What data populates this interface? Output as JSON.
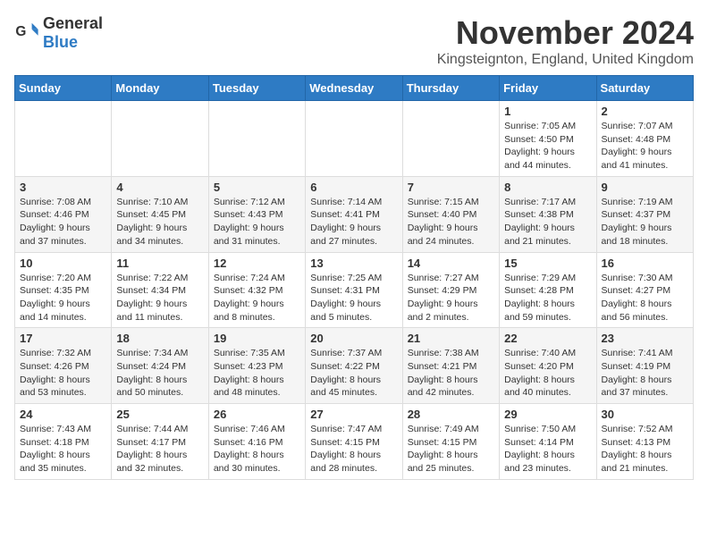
{
  "logo": {
    "text_general": "General",
    "text_blue": "Blue"
  },
  "title": "November 2024",
  "location": "Kingsteignton, England, United Kingdom",
  "days_of_week": [
    "Sunday",
    "Monday",
    "Tuesday",
    "Wednesday",
    "Thursday",
    "Friday",
    "Saturday"
  ],
  "weeks": [
    [
      {
        "day": "",
        "info": ""
      },
      {
        "day": "",
        "info": ""
      },
      {
        "day": "",
        "info": ""
      },
      {
        "day": "",
        "info": ""
      },
      {
        "day": "",
        "info": ""
      },
      {
        "day": "1",
        "info": "Sunrise: 7:05 AM\nSunset: 4:50 PM\nDaylight: 9 hours and 44 minutes."
      },
      {
        "day": "2",
        "info": "Sunrise: 7:07 AM\nSunset: 4:48 PM\nDaylight: 9 hours and 41 minutes."
      }
    ],
    [
      {
        "day": "3",
        "info": "Sunrise: 7:08 AM\nSunset: 4:46 PM\nDaylight: 9 hours and 37 minutes."
      },
      {
        "day": "4",
        "info": "Sunrise: 7:10 AM\nSunset: 4:45 PM\nDaylight: 9 hours and 34 minutes."
      },
      {
        "day": "5",
        "info": "Sunrise: 7:12 AM\nSunset: 4:43 PM\nDaylight: 9 hours and 31 minutes."
      },
      {
        "day": "6",
        "info": "Sunrise: 7:14 AM\nSunset: 4:41 PM\nDaylight: 9 hours and 27 minutes."
      },
      {
        "day": "7",
        "info": "Sunrise: 7:15 AM\nSunset: 4:40 PM\nDaylight: 9 hours and 24 minutes."
      },
      {
        "day": "8",
        "info": "Sunrise: 7:17 AM\nSunset: 4:38 PM\nDaylight: 9 hours and 21 minutes."
      },
      {
        "day": "9",
        "info": "Sunrise: 7:19 AM\nSunset: 4:37 PM\nDaylight: 9 hours and 18 minutes."
      }
    ],
    [
      {
        "day": "10",
        "info": "Sunrise: 7:20 AM\nSunset: 4:35 PM\nDaylight: 9 hours and 14 minutes."
      },
      {
        "day": "11",
        "info": "Sunrise: 7:22 AM\nSunset: 4:34 PM\nDaylight: 9 hours and 11 minutes."
      },
      {
        "day": "12",
        "info": "Sunrise: 7:24 AM\nSunset: 4:32 PM\nDaylight: 9 hours and 8 minutes."
      },
      {
        "day": "13",
        "info": "Sunrise: 7:25 AM\nSunset: 4:31 PM\nDaylight: 9 hours and 5 minutes."
      },
      {
        "day": "14",
        "info": "Sunrise: 7:27 AM\nSunset: 4:29 PM\nDaylight: 9 hours and 2 minutes."
      },
      {
        "day": "15",
        "info": "Sunrise: 7:29 AM\nSunset: 4:28 PM\nDaylight: 8 hours and 59 minutes."
      },
      {
        "day": "16",
        "info": "Sunrise: 7:30 AM\nSunset: 4:27 PM\nDaylight: 8 hours and 56 minutes."
      }
    ],
    [
      {
        "day": "17",
        "info": "Sunrise: 7:32 AM\nSunset: 4:26 PM\nDaylight: 8 hours and 53 minutes."
      },
      {
        "day": "18",
        "info": "Sunrise: 7:34 AM\nSunset: 4:24 PM\nDaylight: 8 hours and 50 minutes."
      },
      {
        "day": "19",
        "info": "Sunrise: 7:35 AM\nSunset: 4:23 PM\nDaylight: 8 hours and 48 minutes."
      },
      {
        "day": "20",
        "info": "Sunrise: 7:37 AM\nSunset: 4:22 PM\nDaylight: 8 hours and 45 minutes."
      },
      {
        "day": "21",
        "info": "Sunrise: 7:38 AM\nSunset: 4:21 PM\nDaylight: 8 hours and 42 minutes."
      },
      {
        "day": "22",
        "info": "Sunrise: 7:40 AM\nSunset: 4:20 PM\nDaylight: 8 hours and 40 minutes."
      },
      {
        "day": "23",
        "info": "Sunrise: 7:41 AM\nSunset: 4:19 PM\nDaylight: 8 hours and 37 minutes."
      }
    ],
    [
      {
        "day": "24",
        "info": "Sunrise: 7:43 AM\nSunset: 4:18 PM\nDaylight: 8 hours and 35 minutes."
      },
      {
        "day": "25",
        "info": "Sunrise: 7:44 AM\nSunset: 4:17 PM\nDaylight: 8 hours and 32 minutes."
      },
      {
        "day": "26",
        "info": "Sunrise: 7:46 AM\nSunset: 4:16 PM\nDaylight: 8 hours and 30 minutes."
      },
      {
        "day": "27",
        "info": "Sunrise: 7:47 AM\nSunset: 4:15 PM\nDaylight: 8 hours and 28 minutes."
      },
      {
        "day": "28",
        "info": "Sunrise: 7:49 AM\nSunset: 4:15 PM\nDaylight: 8 hours and 25 minutes."
      },
      {
        "day": "29",
        "info": "Sunrise: 7:50 AM\nSunset: 4:14 PM\nDaylight: 8 hours and 23 minutes."
      },
      {
        "day": "30",
        "info": "Sunrise: 7:52 AM\nSunset: 4:13 PM\nDaylight: 8 hours and 21 minutes."
      }
    ]
  ]
}
